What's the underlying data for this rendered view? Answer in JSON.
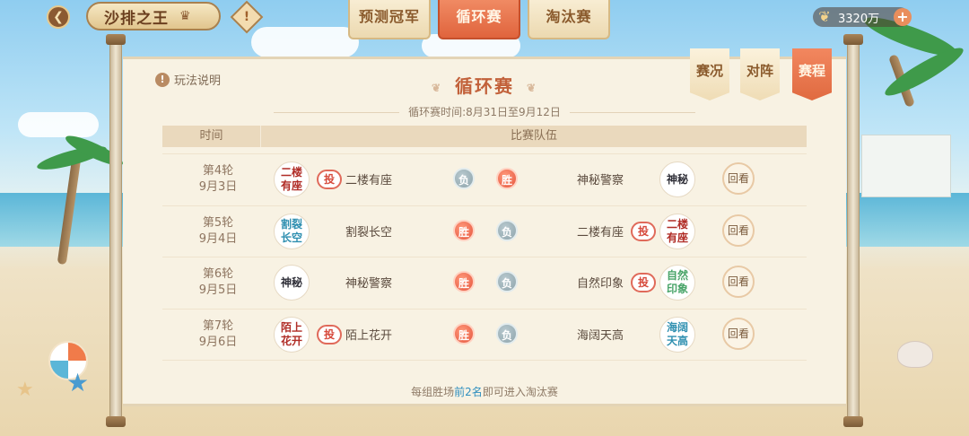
{
  "header": {
    "back_icon": "back-arrow-icon",
    "title": "沙排之王",
    "title_icon": "crown-icon",
    "info_icon": "exclamation-icon",
    "coins": "3320万",
    "tabs": [
      {
        "label": "预测冠军",
        "active": false
      },
      {
        "label": "循环赛",
        "active": true
      },
      {
        "label": "淘汰赛",
        "active": false
      }
    ]
  },
  "panel": {
    "rules_label": "玩法说明",
    "title": "循环赛",
    "period": "循环赛时间:8月31日至9月12日",
    "side_tabs": [
      {
        "label": "赛况",
        "active": false
      },
      {
        "label": "对阵",
        "active": false
      },
      {
        "label": "赛程",
        "active": true
      }
    ],
    "columns": {
      "time": "时间",
      "teams": "比赛队伍"
    },
    "rows": [
      {
        "round": "第4轮",
        "date": "9月3日",
        "left_team": "二楼有座",
        "left_emblem": "二楼\n有座",
        "left_bet": "投",
        "left_result": "负",
        "right_result": "胜",
        "right_team": "神秘警察",
        "right_emblem": "神秘",
        "right_bet": "",
        "replay": "回看"
      },
      {
        "round": "第5轮",
        "date": "9月4日",
        "left_team": "割裂长空",
        "left_emblem": "割裂\n长空",
        "left_bet": "",
        "left_result": "胜",
        "right_result": "负",
        "right_team": "二楼有座",
        "right_emblem": "二楼\n有座",
        "right_bet": "投",
        "replay": "回看"
      },
      {
        "round": "第6轮",
        "date": "9月5日",
        "left_team": "神秘警察",
        "left_emblem": "神秘",
        "left_bet": "",
        "left_result": "胜",
        "right_result": "负",
        "right_team": "自然印象",
        "right_emblem": "自然\n印象",
        "right_bet": "投",
        "replay": "回看"
      },
      {
        "round": "第7轮",
        "date": "9月6日",
        "left_team": "陌上花开",
        "left_emblem": "陌上\n花开",
        "left_bet": "投",
        "left_result": "胜",
        "right_result": "负",
        "right_team": "海阔天高",
        "right_emblem": "海阔\n天高",
        "right_bet": "",
        "replay": "回看"
      }
    ],
    "footer": {
      "prefix": "每组胜场",
      "highlight": "前2名",
      "suffix": "即可进入淘汰赛"
    }
  },
  "colors": {
    "accent": "#e0643d",
    "win": "#e5543c",
    "lose": "#8ea4ab",
    "highlight": "#2f8fbf"
  }
}
